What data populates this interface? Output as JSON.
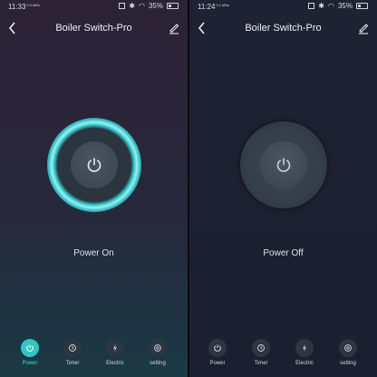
{
  "panels": [
    {
      "status_time": "11:33",
      "status_time_sub": "0.0 kB/s",
      "battery": "35%",
      "title": "Boiler Switch-Pro",
      "power_state": "Power On",
      "power_on": true,
      "nav": [
        {
          "label": "Power",
          "icon": "power-icon",
          "active": true
        },
        {
          "label": "Timer",
          "icon": "timer-icon",
          "active": false
        },
        {
          "label": "Electric",
          "icon": "lightning-icon",
          "active": false
        },
        {
          "label": "setting",
          "icon": "gear-icon",
          "active": false
        }
      ]
    },
    {
      "status_time": "11:24",
      "status_time_sub": "0.1 kB/s",
      "battery": "35%",
      "title": "Boiler Switch-Pro",
      "power_state": "Power Off",
      "power_on": false,
      "nav": [
        {
          "label": "Power",
          "icon": "power-icon",
          "active": false
        },
        {
          "label": "Timer",
          "icon": "timer-icon",
          "active": false
        },
        {
          "label": "Electric",
          "icon": "lightning-icon",
          "active": false
        },
        {
          "label": "setting",
          "icon": "gear-icon",
          "active": false
        }
      ]
    }
  ],
  "colors": {
    "accent": "#36c4c2",
    "left_bg": "#2a2439",
    "right_bg": "#1d2132"
  }
}
